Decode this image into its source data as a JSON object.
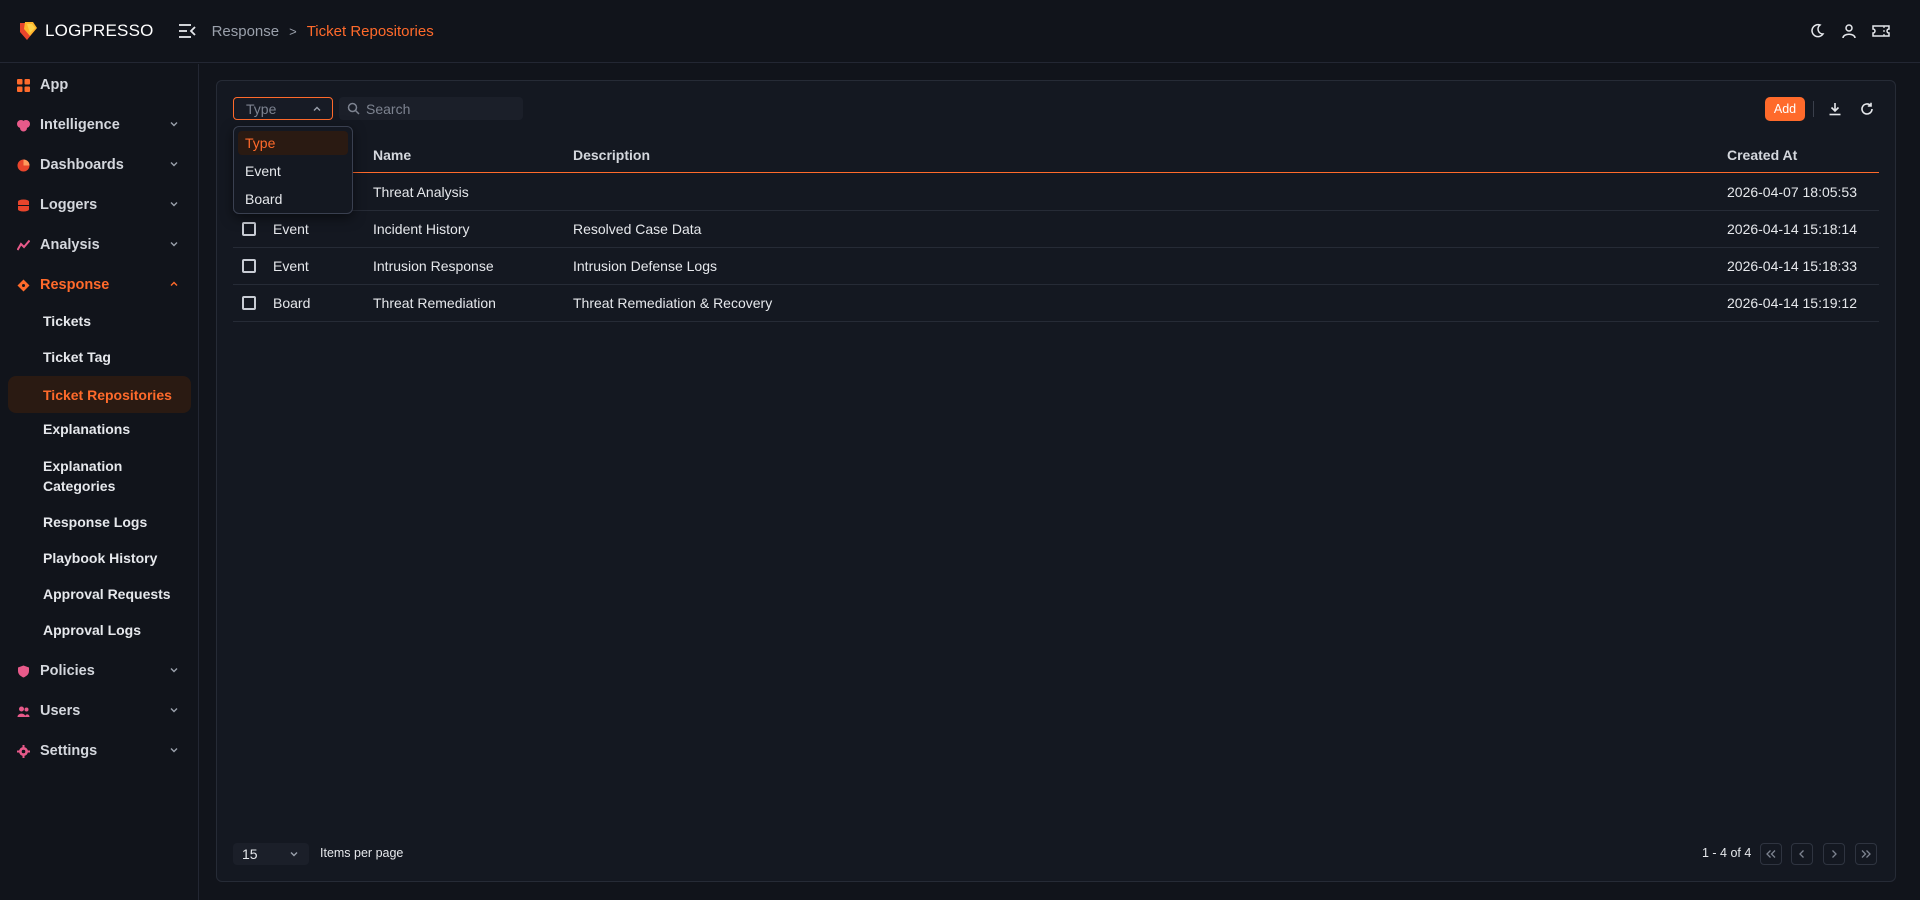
{
  "app": {
    "logo_text": "LOGPRESSO"
  },
  "breadcrumb": {
    "parent": "Response",
    "separator": ">",
    "current": "Ticket Repositories"
  },
  "header_icons": [
    "moon-icon",
    "user-icon",
    "ticket-icon"
  ],
  "sidebar": {
    "groups": [
      {
        "label": "App",
        "icon": "grid-icon",
        "expandable": false
      },
      {
        "label": "Intelligence",
        "icon": "brain-icon",
        "expandable": true
      },
      {
        "label": "Dashboards",
        "icon": "pie-chart-icon",
        "expandable": true
      },
      {
        "label": "Loggers",
        "icon": "database-icon",
        "expandable": true
      },
      {
        "label": "Analysis",
        "icon": "chart-line-icon",
        "expandable": true
      },
      {
        "label": "Response",
        "icon": "ticket-icon",
        "expandable": true,
        "expanded": true,
        "active": true
      },
      {
        "label": "Policies",
        "icon": "shield-icon",
        "expandable": true
      },
      {
        "label": "Users",
        "icon": "users-icon",
        "expandable": true
      },
      {
        "label": "Settings",
        "icon": "gear-icon",
        "expandable": true
      }
    ],
    "response_items": [
      {
        "label": "Tickets"
      },
      {
        "label": "Ticket Tag"
      },
      {
        "label": "Ticket Repositories",
        "active": true
      },
      {
        "label": "Explanations"
      },
      {
        "label": "Explanation Categories"
      },
      {
        "label": "Response Logs"
      },
      {
        "label": "Playbook History"
      },
      {
        "label": "Approval Requests"
      },
      {
        "label": "Approval Logs"
      }
    ]
  },
  "toolbar": {
    "type_filter_value": "Type",
    "search_placeholder": "Search",
    "add_label": "Add"
  },
  "type_dropdown": {
    "options": [
      "Type",
      "Event",
      "Board"
    ],
    "selected": "Type"
  },
  "table": {
    "columns": [
      "Name",
      "Description",
      "Created At"
    ],
    "rows": [
      {
        "type": "",
        "name": "Threat Analysis",
        "description": "",
        "created_at": "2026-04-07 18:05:53"
      },
      {
        "type": "Event",
        "name": "Incident History",
        "description": "Resolved Case Data",
        "created_at": "2026-04-14 15:18:14"
      },
      {
        "type": "Event",
        "name": "Intrusion Response",
        "description": "Intrusion Defense Logs",
        "created_at": "2026-04-14 15:18:33"
      },
      {
        "type": "Board",
        "name": "Threat Remediation",
        "description": "Threat Remediation & Recovery",
        "created_at": "2026-04-14 15:19:12"
      }
    ]
  },
  "pagination": {
    "items_per_page": "15",
    "items_per_page_label": "Items per page",
    "range": "1 - 4 of 4"
  },
  "colors": {
    "accent": "#ff6a2b",
    "background": "#11141b",
    "panel": "#141821"
  }
}
